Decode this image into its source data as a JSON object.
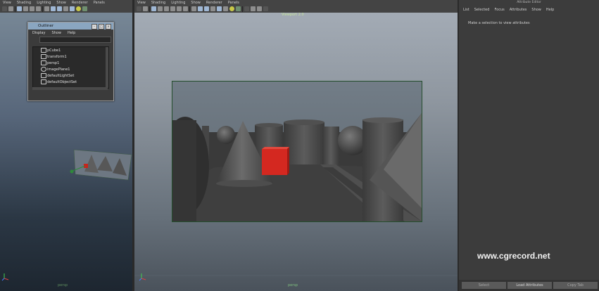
{
  "left_viewport": {
    "menu": [
      "View",
      "Shading",
      "Lighting",
      "Show",
      "Renderer",
      "Panels"
    ],
    "camera_label": "persp"
  },
  "center_viewport": {
    "menu": [
      "View",
      "Shading",
      "Lighting",
      "Show",
      "Renderer",
      "Panels"
    ],
    "viewport_label": "Viewport 2.0",
    "camera_label": "persp"
  },
  "outliner": {
    "title": "Outliner",
    "menu": [
      "Display",
      "Show",
      "Help"
    ],
    "items": [
      "pCube1",
      "transform1",
      "persp1",
      "imagePlane1",
      "defaultLightSet",
      "defaultObjectSet"
    ]
  },
  "attribute_editor": {
    "title": "Attribute Editor",
    "menu": [
      "List",
      "Selected",
      "Focus",
      "Attributes",
      "Show",
      "Help"
    ],
    "hint": "Make a selection to view attributes",
    "buttons": [
      "Select",
      "Load Attributes",
      "Copy Tab"
    ]
  },
  "watermark": "www.cgrecord.net",
  "colors": {
    "cube": "#d42820",
    "frame": "#244e2c"
  }
}
